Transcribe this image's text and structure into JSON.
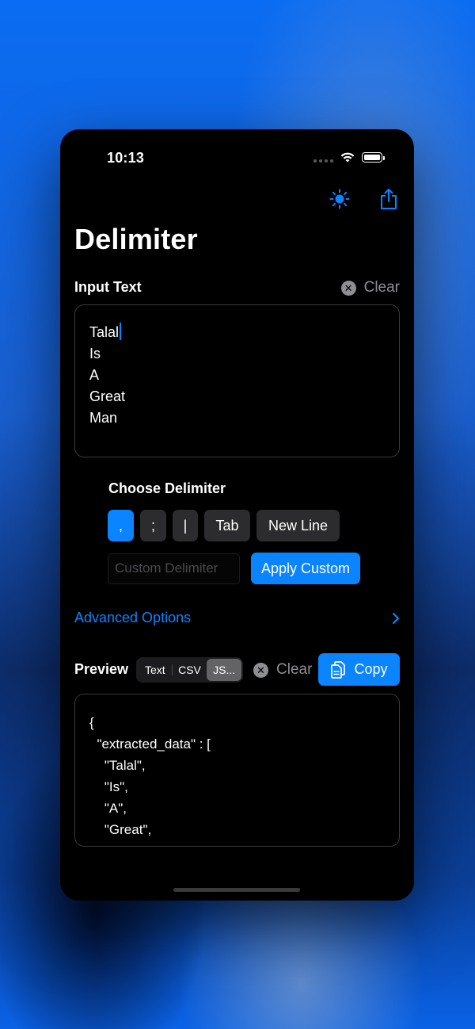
{
  "status": {
    "time": "10:13"
  },
  "header": {
    "title": "Delimiter"
  },
  "input": {
    "label": "Input Text",
    "clear_label": "Clear",
    "lines": [
      "Talal",
      "Is",
      "A",
      "Great",
      "Man"
    ]
  },
  "delimiter": {
    "label": "Choose Delimiter",
    "options": [
      ",",
      ";",
      "|",
      "Tab",
      "New Line"
    ],
    "selected": ",",
    "custom_placeholder": "Custom Delimiter",
    "apply_label": "Apply Custom"
  },
  "advanced": {
    "label": "Advanced Options"
  },
  "preview": {
    "label": "Preview",
    "formats": [
      "Text",
      "CSV",
      "JS..."
    ],
    "selected_format": "JS...",
    "clear_label": "Clear",
    "copy_label": "Copy",
    "lines": [
      "{",
      "  \"extracted_data\" : [",
      "    \"Talal\",",
      "    \"Is\",",
      "    \"A\",",
      "    \"Great\","
    ]
  },
  "colors": {
    "accent": "#0a84ff",
    "background": "#000000",
    "chip": "#2c2c2e"
  },
  "icons": [
    "sun-icon",
    "share-icon",
    "clear-icon",
    "copy-icon",
    "chevron-right-icon",
    "wifi-icon",
    "battery-icon"
  ]
}
